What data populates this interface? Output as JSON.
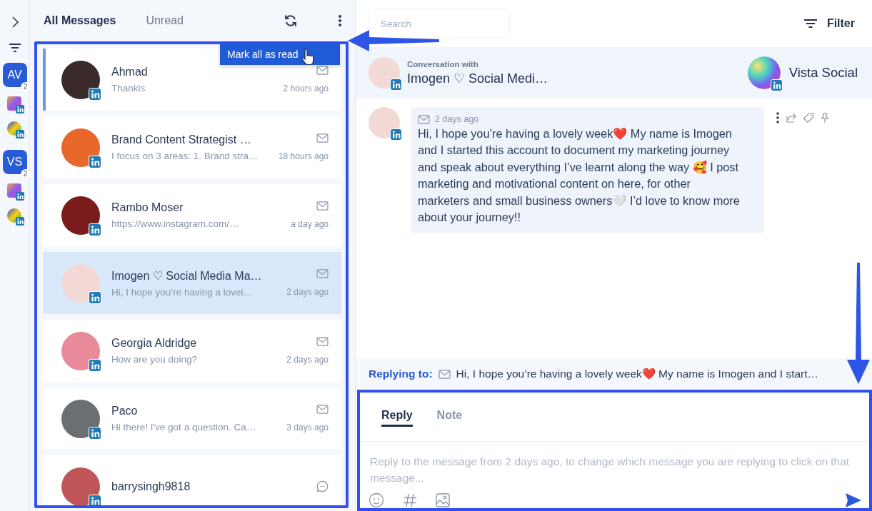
{
  "rail": {
    "accounts": [
      {
        "initials": "AV",
        "count": "2"
      },
      {
        "initials": "VS",
        "count": "2"
      }
    ]
  },
  "list_tabs": [
    {
      "label": "All Messages",
      "selected": true
    },
    {
      "label": "Unread",
      "selected": false
    }
  ],
  "menu": {
    "items": [
      "Mark all as read"
    ]
  },
  "message_list": {
    "highlighted": true
  },
  "conversations": [
    {
      "name": "Ahmad",
      "preview": "Thankls",
      "time": "2 hours ago",
      "unread": true,
      "selected": false,
      "kind": "mail",
      "color": "#3a2a2a"
    },
    {
      "name": "Brand Content Strategist …",
      "preview": "I focus on 3 areas: 1. Brand stra…",
      "time": "18 hours ago",
      "unread": false,
      "selected": false,
      "kind": "mail",
      "color": "#e8672a"
    },
    {
      "name": "Rambo Moser",
      "preview": "https://www.instagram.com/…",
      "time": "a day ago",
      "unread": false,
      "selected": false,
      "kind": "mail",
      "color": "#7a1c1c"
    },
    {
      "name": "Imogen ♡ Social Media Ma…",
      "preview": "Hi, I hope you’re having a lovel…",
      "time": "2 days ago",
      "unread": false,
      "selected": true,
      "kind": "mail",
      "color": "#f3d9d6"
    },
    {
      "name": "Georgia Aldridge",
      "preview": "How are you doing?",
      "time": "2 days ago",
      "unread": false,
      "selected": false,
      "kind": "mail",
      "color": "#e98a9a"
    },
    {
      "name": "Paco",
      "preview": "Hi there! I've got a question. Ca…",
      "time": "3 days ago",
      "unread": false,
      "selected": false,
      "kind": "mail",
      "color": "#6b6f72"
    },
    {
      "name": "barrysingh9818",
      "unread": false,
      "selected": false,
      "kind": "chat",
      "color": "#c0565a"
    }
  ],
  "search": {
    "placeholder": "Search"
  },
  "filter": {
    "label": "Filter"
  },
  "conversation": {
    "caption": "Conversation with",
    "contact": "Imogen ♡ Social Medi…",
    "account": "Vista Social"
  },
  "messages": [
    {
      "time": "2 days ago",
      "text": "Hi, I hope you’re having a lovely week❤️ My name is Imogen and I started this account to document my marketing journey and speak about everything I’ve learnt along the way 🥰 I post marketing and motivational content on here, for other marketers and small business owners🤍 I’d love to know more about your journey!!"
    }
  ],
  "replying_to": {
    "label": "Replying to:",
    "text": "Hi, I hope you’re having a lovely week❤️ My name is Imogen and I start…"
  },
  "composer": {
    "highlighted": true,
    "tabs": [
      {
        "label": "Reply",
        "selected": true
      },
      {
        "label": "Note",
        "selected": false
      }
    ],
    "placeholder": "Reply to the message from 2 days ago, to change which message you are replying to click on that message..."
  }
}
